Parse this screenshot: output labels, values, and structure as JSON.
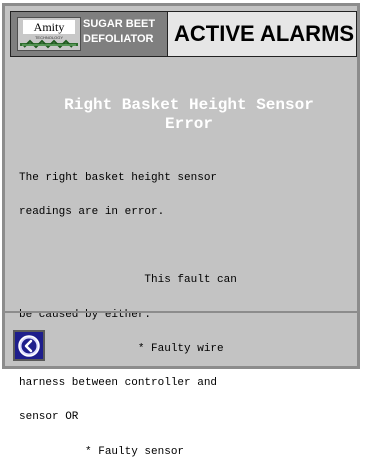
{
  "header": {
    "brand_logo_text": "Amity",
    "brand_logo_subtext": "TECHNOLOGY",
    "product_line1": "SUGAR BEET",
    "product_line2": "DEFOLIATOR",
    "screen_title": "ACTIVE ALARMS"
  },
  "alarm": {
    "title_line1": "Right Basket Height Sensor",
    "title_line2": "Error",
    "body_lines": [
      "The right basket height sensor",
      "readings are in error.",
      "",
      "                   This fault can",
      "be caused by either:",
      "                  * Faulty wire",
      "harness between controller and",
      "sensor OR",
      "          * Faulty sensor"
    ]
  },
  "footer": {
    "back_icon": "chevron-left-icon"
  },
  "colors": {
    "panel_bg": "#c3c3c3",
    "header_bg": "#e6e6e6",
    "brand_bg": "#7f7f7f",
    "back_button_bg": "#1e1e8c",
    "alarm_title": "#ffffff"
  }
}
